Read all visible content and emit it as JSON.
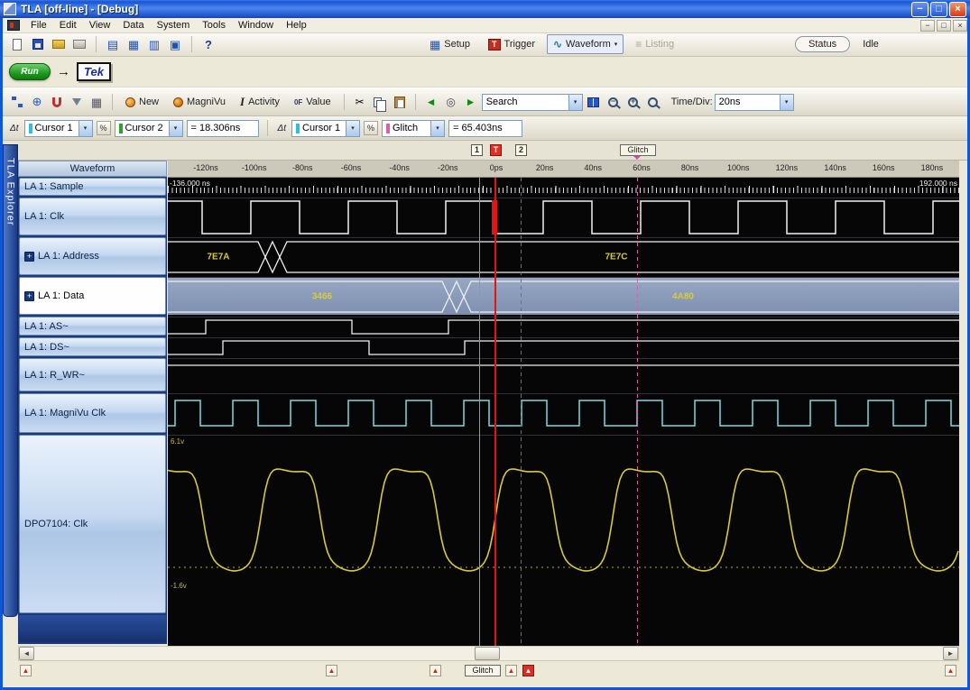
{
  "titlebar": {
    "title": "TLA [off-line] - [Debug]"
  },
  "menubar": {
    "items": [
      "File",
      "Edit",
      "View",
      "Data",
      "System",
      "Tools",
      "Window",
      "Help"
    ]
  },
  "toolbar1": {
    "setup": "Setup",
    "trigger": "Trigger",
    "waveform": "Wa​veform",
    "listing": "Listing",
    "status_label": "Status",
    "status_value": "Idle"
  },
  "runbar": {
    "run": "Run",
    "logo": "Tek"
  },
  "toolbar2": {
    "new": "New",
    "magnivu": "MagniVu",
    "activity": "Activity",
    "value": "Value",
    "search_value": "Search",
    "timediv_label": "Time/Div:",
    "timediv_value": "20ns"
  },
  "cursorbar": {
    "group1": {
      "sel_a": "Cursor 1",
      "sel_b": "Cursor 2",
      "readout": "= 18.306ns"
    },
    "group2": {
      "sel_a": "Cursor 1",
      "sel_b": "Glitch",
      "readout": "= 65.403ns"
    }
  },
  "explorer_tab": "TLA Explorer",
  "ruler": {
    "marker1": "1",
    "trigger": "T",
    "marker2": "2",
    "glitch": "Glitch"
  },
  "waveform": {
    "header": "Waveform",
    "range_start": "-136.000 ns",
    "range_end": "192.000 ns",
    "ticks": [
      "-120ns",
      "-100ns",
      "-80ns",
      "-60ns",
      "-40ns",
      "-20ns",
      "0ps",
      "20ns",
      "40ns",
      "60ns",
      "80ns",
      "100ns",
      "120ns",
      "140ns",
      "160ns",
      "180ns"
    ],
    "rows": [
      {
        "label": "LA 1: Sample"
      },
      {
        "label": "LA 1: Clk"
      },
      {
        "label": "LA 1: Address",
        "values": [
          "7E7A",
          "7E7C"
        ]
      },
      {
        "label": "LA 1: Data",
        "values": [
          "3466",
          "4A80"
        ]
      },
      {
        "label": "LA 1: AS~"
      },
      {
        "label": "LA 1: DS~"
      },
      {
        "label": "LA 1: R_WR~"
      },
      {
        "label": "LA 1: MagniVu Clk"
      },
      {
        "label": "DPO7104: Clk",
        "vmax": "6.1v",
        "vmin": "-1.6v"
      }
    ]
  },
  "bottom": {
    "glitch": "Glitch"
  },
  "icons": {
    "expand": "+",
    "dropdown": "▾",
    "left_arrow": "◄",
    "right_arrow": "►",
    "up_marker": "▲",
    "run_arrow": "→",
    "help": "?",
    "win_a": "▤",
    "win_b": "▦",
    "win_c": "▥",
    "win_d": "▣",
    "wave": "∿",
    "listing": "≡",
    "cut": "✂",
    "target": "◎",
    "setup_grid": "▦",
    "trigger_t": "T",
    "delta": "Δt",
    "percent": "%",
    "activity": "I",
    "value": "0F",
    "minimize": "−",
    "maximize": "□",
    "close": "×",
    "restore": "□",
    "circle_plus": "⊕"
  },
  "colors": {
    "trace": "#f0f0f0",
    "magnivu": "#7ed8e0",
    "analog": "#d8ca3a",
    "cursor1": "#2ec0d4",
    "cursor2": "#2f9f2f",
    "trigger": "#e21414",
    "glitch": "#da5fb0"
  }
}
